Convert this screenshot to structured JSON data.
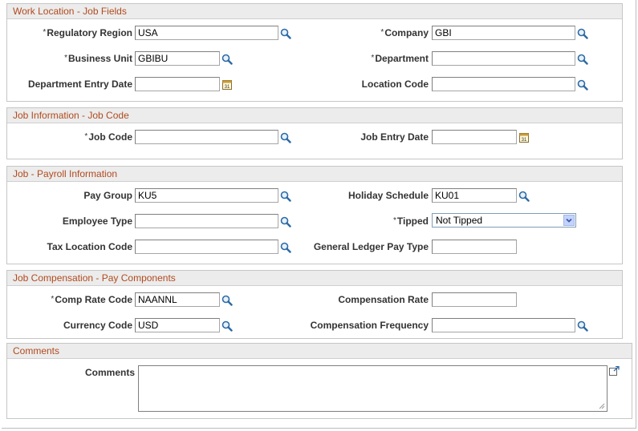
{
  "sections": {
    "work_location": {
      "title": "Work Location - Job Fields",
      "regulatory_region": {
        "label": "Regulatory Region",
        "value": "USA"
      },
      "company": {
        "label": "Company",
        "value": "GBI"
      },
      "business_unit": {
        "label": "Business Unit",
        "value": "GBIBU"
      },
      "department": {
        "label": "Department",
        "value": ""
      },
      "department_entry_date": {
        "label": "Department Entry Date",
        "value": ""
      },
      "location_code": {
        "label": "Location Code",
        "value": ""
      }
    },
    "job_information": {
      "title": "Job Information - Job Code",
      "job_code": {
        "label": "Job Code",
        "value": ""
      },
      "job_entry_date": {
        "label": "Job Entry Date",
        "value": ""
      }
    },
    "payroll": {
      "title": "Job - Payroll Information",
      "pay_group": {
        "label": "Pay Group",
        "value": "KU5"
      },
      "holiday_schedule": {
        "label": "Holiday Schedule",
        "value": "KU01"
      },
      "employee_type": {
        "label": "Employee Type",
        "value": ""
      },
      "tipped": {
        "label": "Tipped",
        "value": "Not Tipped"
      },
      "tax_location_code": {
        "label": "Tax Location Code",
        "value": ""
      },
      "gl_pay_type": {
        "label": "General Ledger Pay Type",
        "value": ""
      }
    },
    "compensation": {
      "title": "Job Compensation - Pay Components",
      "comp_rate_code": {
        "label": "Comp Rate Code",
        "value": "NAANNL"
      },
      "compensation_rate": {
        "label": "Compensation Rate",
        "value": ""
      },
      "currency_code": {
        "label": "Currency Code",
        "value": "USD"
      },
      "compensation_frequency": {
        "label": "Compensation Frequency",
        "value": ""
      }
    },
    "comments": {
      "title": "Comments",
      "comments": {
        "label": "Comments",
        "value": ""
      }
    }
  },
  "required_marker": "*",
  "colors": {
    "section_title": "#b14a1e",
    "section_header_bg": "#ececec",
    "lookup_icon": "#2d6aa5"
  },
  "icons": {
    "lookup": "magnifier-icon",
    "calendar": "calendar-icon",
    "expand": "expand-icon",
    "dropdown": "chevron-down-icon"
  }
}
